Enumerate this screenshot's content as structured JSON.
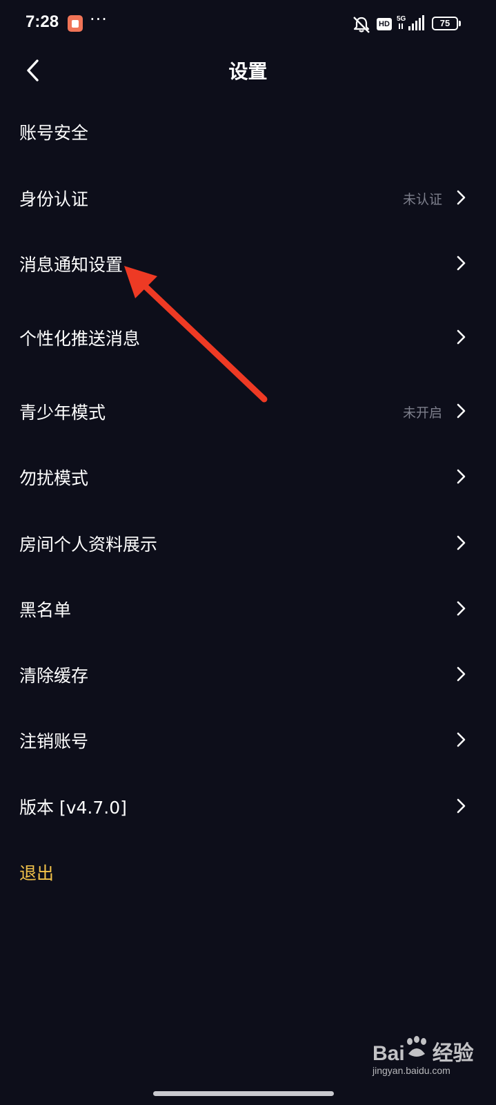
{
  "status_bar": {
    "time": "7:28",
    "dots": "···",
    "hd_label": "HD",
    "network_label": "5G",
    "battery_level": "75"
  },
  "header": {
    "title": "设置"
  },
  "settings": {
    "items": [
      {
        "label": "账号安全",
        "status": "",
        "chevron": false
      },
      {
        "label": "身份认证",
        "status": "未认证",
        "chevron": true
      },
      {
        "label": "消息通知设置",
        "status": "",
        "chevron": true
      },
      {
        "label": "个性化推送消息",
        "status": "",
        "chevron": true
      },
      {
        "label": "青少年模式",
        "status": "未开启",
        "chevron": true
      },
      {
        "label": "勿扰模式",
        "status": "",
        "chevron": true
      },
      {
        "label": "房间个人资料展示",
        "status": "",
        "chevron": true
      },
      {
        "label": "黑名单",
        "status": "",
        "chevron": true
      },
      {
        "label": "清除缓存",
        "status": "",
        "chevron": true
      },
      {
        "label": "注销账号",
        "status": "",
        "chevron": true
      },
      {
        "label": "版本 [v4.7.0]",
        "status": "",
        "chevron": true
      }
    ],
    "logout_label": "退出"
  },
  "watermark": {
    "brand": "Bai",
    "brand_suffix": "经验",
    "url": "jingyan.baidu.com"
  },
  "colors": {
    "background": "#0d0e1a",
    "text_primary": "#ffffff",
    "text_secondary": "#7d7f8c",
    "logout": "#f2c24a",
    "annotation_arrow": "#ee3a24"
  }
}
